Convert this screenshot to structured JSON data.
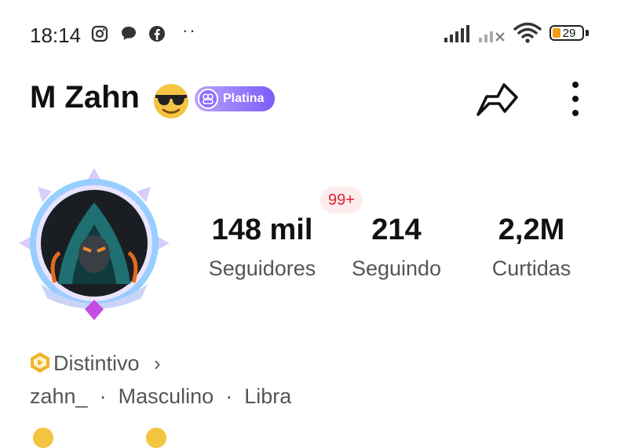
{
  "status_bar": {
    "time": "18:14",
    "battery": "29",
    "more_dots": "··",
    "icons": [
      "instagram-icon",
      "chat-bubble-icon",
      "facebook-icon",
      "signal-icon",
      "signal-off-icon",
      "wifi-icon",
      "battery-icon"
    ]
  },
  "header": {
    "name": "M Zahn",
    "emoji": "sunglasses-emoji",
    "badge_label": "Platina",
    "badge_color": "#7c5cf7"
  },
  "stats": {
    "notification": "99+",
    "items": [
      {
        "value": "148 mil",
        "label": "Seguidores"
      },
      {
        "value": "214",
        "label": "Seguindo"
      },
      {
        "value": "2,2M",
        "label": "Curtidas"
      }
    ]
  },
  "profile": {
    "distintivo": "Distintivo",
    "chevron": "›",
    "meta_username": "zahn_",
    "meta_gender": "Masculino",
    "meta_sign": "Libra",
    "separator": "·"
  },
  "colors": {
    "accent_notification": "#e0202f",
    "badge_gold": "#f0b429"
  }
}
